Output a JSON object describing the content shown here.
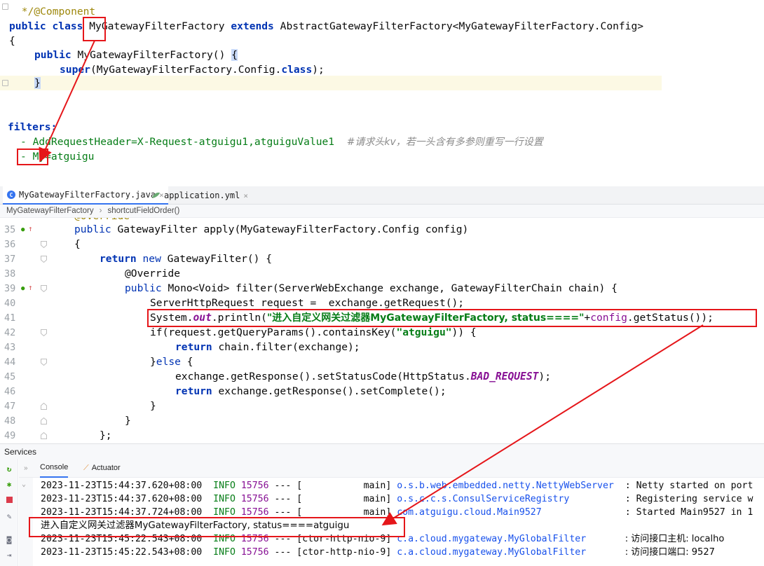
{
  "top_snippet": {
    "line1_comment": " */@Component",
    "line2": {
      "kw1": "public",
      "kw2": "class",
      "class_name": "MyGatewayFilterFactory",
      "kw3": "extends",
      "superclass": "AbstractGatewayFilterFactory<MyGatewayFilterFactory.Config>"
    },
    "line3": "{",
    "line4": {
      "kw": "public",
      "rest": "MyGatewayFilterFactory() ",
      "brace": "{"
    },
    "line5": {
      "kw": "super",
      "rest_a": "(MyGatewayFilterFactory.Config.",
      "kw2": "class",
      "rest_b": ");"
    },
    "line6": "}",
    "yaml_key": "filters:",
    "yaml_item1": "- AddRequestHeader=X-Request-atguigu1,atguiguValue1",
    "yaml_item1_comment": "#请求头kv，若一头含有多参则重写一行设置",
    "yaml_item2": "- My=atguigu"
  },
  "tabs": [
    {
      "label": "MyGatewayFilterFactory.java",
      "icon": "class-icon",
      "active": true
    },
    {
      "label": "application.yml",
      "icon": "yml-icon",
      "active": false
    }
  ],
  "breadcrumb": [
    "MyGatewayFilterFactory",
    "shortcutFieldOrder()"
  ],
  "editor": {
    "lines": [
      {
        "n": "35",
        "code": "public GatewayFilter apply(MyGatewayFilterFactory.Config config)"
      },
      {
        "n": "36",
        "code": "{"
      },
      {
        "n": "37",
        "code": "return new GatewayFilter() {"
      },
      {
        "n": "38",
        "code": "@Override"
      },
      {
        "n": "39",
        "code": "public Mono<Void> filter(ServerWebExchange exchange, GatewayFilterChain chain) {"
      },
      {
        "n": "40",
        "code": "ServerHttpRequest request =  exchange.getRequest();"
      },
      {
        "n": "41",
        "code": "System.out.println(\"进入自定义网关过滤器MyGatewayFilterFactory, status====\"+config.getStatus());"
      },
      {
        "n": "42",
        "code": "if(request.getQueryParams().containsKey(\"atguigu\")) {"
      },
      {
        "n": "43",
        "code": "return chain.filter(exchange);"
      },
      {
        "n": "44",
        "code": "}else {"
      },
      {
        "n": "45",
        "code": "exchange.getResponse().setStatusCode(HttpStatus.BAD_REQUEST);"
      },
      {
        "n": "46",
        "code": "return exchange.getResponse().setComplete();"
      },
      {
        "n": "47",
        "code": "}"
      },
      {
        "n": "48",
        "code": "}"
      },
      {
        "n": "49",
        "code": "};"
      }
    ],
    "line41_parts": {
      "a": "System.",
      "out": "out",
      "b": ".println(",
      "str": "\"进入自定义网关过滤器MyGatewayFilterFactory, status====\"",
      "c": "+",
      "config": "config",
      "d": ".getStatus());"
    },
    "line42_parts": {
      "a": "if(request.getQueryParams().containsKey(",
      "str": "\"atguigu\"",
      "b": ")) {"
    },
    "line45_parts": {
      "a": "exchange.getResponse().setStatusCode(HttpStatus.",
      "const": "BAD_REQUEST",
      "b": ");"
    }
  },
  "services": {
    "title": "Services",
    "tabs": [
      "Console",
      "Actuator"
    ]
  },
  "console": {
    "lines": [
      {
        "ts": "2023-11-23T15:44:37.620+08:00",
        "level": "INFO",
        "pid": "15756",
        "sep": "---",
        "thread": "[           main]",
        "logger": "o.s.b.web.embedded.netty.NettyWebServer",
        "msg": ": Netty started on port"
      },
      {
        "ts": "2023-11-23T15:44:37.620+08:00",
        "level": "INFO",
        "pid": "15756",
        "sep": "---",
        "thread": "[           main]",
        "logger": "o.s.c.c.s.ConsulServiceRegistry",
        "msg": ": Registering service w"
      },
      {
        "ts": "2023-11-23T15:44:37.724+08:00",
        "level": "INFO",
        "pid": "15756",
        "sep": "---",
        "thread": "[           main]",
        "logger": "com.atguigu.cloud.Main9527",
        "msg": ": Started Main9527 in 1"
      },
      {
        "plain": "进入自定义网关过滤器MyGatewayFilterFactory, status====atguigu"
      },
      {
        "ts": "2023-11-23T15:45:22.543+08:00",
        "level": "INFO",
        "pid": "15756",
        "sep": "---",
        "thread": "[ctor-http-nio-9]",
        "logger": "c.a.cloud.mygateway.MyGlobalFilter",
        "msg": ": 访问接口主机: localho"
      },
      {
        "ts": "2023-11-23T15:45:22.543+08:00",
        "level": "INFO",
        "pid": "15756",
        "sep": "---",
        "thread": "[ctor-http-nio-9]",
        "logger": "c.a.cloud.mygateway.MyGlobalFilter",
        "msg": ": 访问接口端口: 9527"
      }
    ]
  },
  "colors": {
    "annotation_red": "#e5161a",
    "keyword": "#0033b3",
    "string": "#067d17",
    "accent": "#3574f0"
  }
}
